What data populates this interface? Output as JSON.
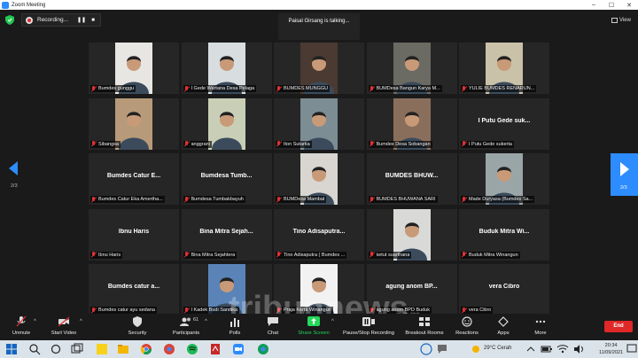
{
  "window": {
    "title": "Zoom Meeting"
  },
  "topbar": {
    "recording_label": "Recording...",
    "talking_text": "Paisal Girsang is talking...",
    "view_label": "View"
  },
  "pagination": {
    "prev_page_label": "2/3",
    "next_page_label": "2/3"
  },
  "tiles": [
    {
      "tag": "Bumdes gunggu",
      "video": true,
      "bg": "#e8e6e2"
    },
    {
      "tag": "I Gede Wartana Desa Pelaga",
      "video": true,
      "bg": "#d8dde0"
    },
    {
      "tag": "BUMDES MUNGGU",
      "video": true,
      "bg": "#4a3a32"
    },
    {
      "tag": "BUMDesa Bangun Karya M...",
      "video": true,
      "bg": "#6b6a63"
    },
    {
      "tag": "YULIE BUMDES RENARUN...",
      "video": true,
      "bg": "#c9c2a9"
    },
    {
      "tag": "Sibangsa",
      "video": true,
      "bg": "#b79a7a"
    },
    {
      "tag": "anggrani",
      "video": true,
      "bg": "#c8cfb6"
    },
    {
      "tag": "Iton Sutarka",
      "video": true,
      "bg": "#7c8d94"
    },
    {
      "tag": "Bumdes Desa Sobangan",
      "video": true,
      "bg": "#8a6e5c"
    },
    {
      "name": "I Putu Gede suk...",
      "tag": "I Putu Gede sukerta",
      "video": false
    },
    {
      "name": "Bumdes Catur E...",
      "tag": "Bumdes Catur Eka Amertha...",
      "video": false
    },
    {
      "name": "Bumdesa Tumb...",
      "tag": "Bumdesa Tumbakbayuh",
      "video": false
    },
    {
      "tag": "BUMDesa Mambal",
      "video": true,
      "bg": "#d9d6d1"
    },
    {
      "name": "BUMDES BHUW...",
      "tag": "BUMDES BHUWANA SARI",
      "video": false
    },
    {
      "tag": "Made Duryasa (Bumdes Sa...",
      "video": true,
      "bg": "#9aa5a8"
    },
    {
      "name": "Ibnu Haris",
      "tag": "Ibnu Haris",
      "video": false
    },
    {
      "name": "Bina Mitra Sejah...",
      "tag": "Bina Mitra Sejahtera",
      "video": false
    },
    {
      "name": "Tino Adisaputra...",
      "tag": "Tino Adisaputra ( Bumdes ...",
      "video": false
    },
    {
      "tag": "ketut suarthana",
      "video": true,
      "bg": "#d9d9d7"
    },
    {
      "name": "Buduk Mitra Wi...",
      "tag": "Buduk Mitra Winangun",
      "video": false
    },
    {
      "name": "Bumdes catur a...",
      "tag": "Bumdes catur ayu sedana",
      "video": false
    },
    {
      "tag": "I Kadek Budi Sandika",
      "video": true,
      "bg": "#5a84b8"
    },
    {
      "tag": "Praja Kerta Winangun",
      "video": true,
      "bg": "#f2f2f2"
    },
    {
      "name": "agung anom BP...",
      "tag": "agung anom BPD Buduk",
      "video": false
    },
    {
      "name": "vera Cibro",
      "tag": "vera Cibro",
      "video": false
    }
  ],
  "toolbar": {
    "unmute": "Unmute",
    "start_video": "Start Video",
    "security": "Security",
    "participants": "Participants",
    "participants_count": "61",
    "polls": "Polls",
    "chat": "Chat",
    "share_screen": "Share Screen",
    "pause_stop_recording": "Pause/Stop Recording",
    "breakout_rooms": "Breakout Rooms",
    "reactions": "Reactions",
    "apps": "Apps",
    "more": "More",
    "end": "End"
  },
  "taskbar": {
    "weather": "29°C  Cerah",
    "time": "20:34",
    "date": "11/09/2021"
  },
  "watermark": {
    "text": "tribunnews.com"
  },
  "colors": {
    "accent": "#2d8cff",
    "share_green": "#23d959",
    "end_red": "#e02828",
    "mute_red": "#e03131"
  }
}
